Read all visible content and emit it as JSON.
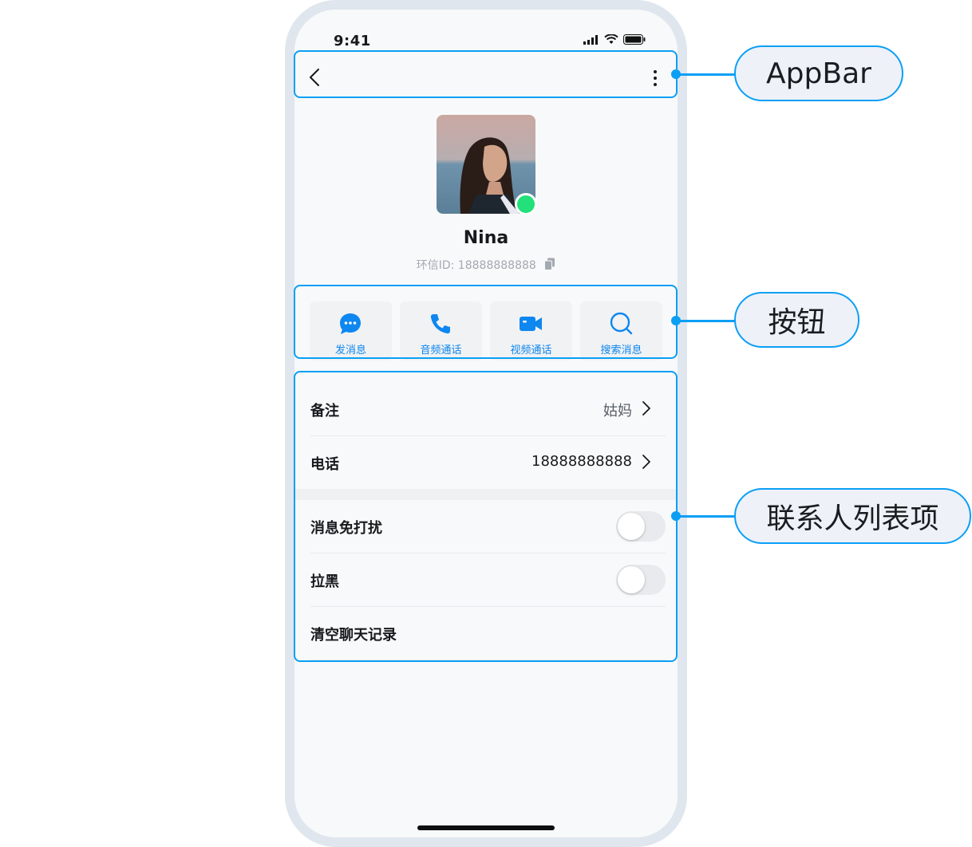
{
  "status_bar": {
    "time": "9:41"
  },
  "profile": {
    "name": "Nina",
    "uid_label": "环信ID: 18888888888"
  },
  "actions": [
    {
      "label": "发消息",
      "icon": "chat-bubble-icon"
    },
    {
      "label": "音频通话",
      "icon": "phone-icon"
    },
    {
      "label": "视频通话",
      "icon": "video-camera-icon"
    },
    {
      "label": "搜索消息",
      "icon": "search-icon"
    }
  ],
  "list": {
    "remark": {
      "label": "备注",
      "value": "姑妈"
    },
    "phone": {
      "label": "电话",
      "value": "18888888888"
    },
    "mute": {
      "label": "消息免打扰",
      "on": false
    },
    "block": {
      "label": "拉黑",
      "on": false
    },
    "clear": {
      "label": "清空聊天记录"
    }
  },
  "annotations": {
    "appbar": "AppBar",
    "buttons": "按钮",
    "list_items": "联系人列表项"
  },
  "colors": {
    "accent": "#0a9ff5",
    "action_text": "#0e87f0",
    "presence": "#22e07a"
  }
}
